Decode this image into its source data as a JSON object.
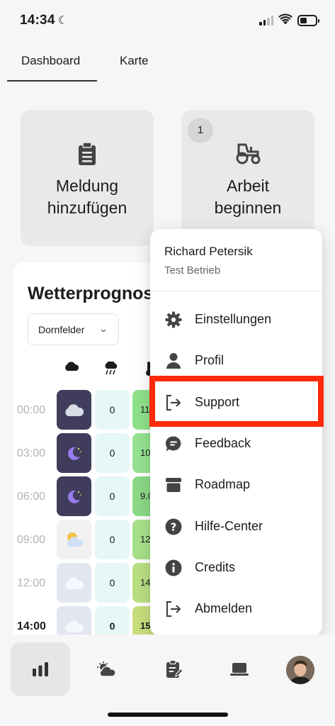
{
  "status_bar": {
    "time": "14:34"
  },
  "tabs": [
    {
      "label": "Dashboard",
      "active": true
    },
    {
      "label": "Karte",
      "active": false
    }
  ],
  "cards": {
    "report": {
      "label": "Meldung\nhinzufügen",
      "icon": "clipboard-icon"
    },
    "work": {
      "label": "Arbeit\nbeginnen",
      "icon": "tractor-icon",
      "badge": "1"
    }
  },
  "weather": {
    "title": "Wetterprognose",
    "location_select": "Dornfelder",
    "columns": [
      "cloud-icon",
      "rain-icon",
      "thermometer-icon"
    ],
    "rows": [
      {
        "time": "00:00",
        "condition": "cloudy-night",
        "rain": "0",
        "temp": "11."
      },
      {
        "time": "03:00",
        "condition": "clear-night",
        "rain": "0",
        "temp": "10."
      },
      {
        "time": "06:00",
        "condition": "clear-night",
        "rain": "0",
        "temp": "9.0"
      },
      {
        "time": "09:00",
        "condition": "partly-sunny",
        "rain": "0",
        "temp": "12."
      },
      {
        "time": "12:00",
        "condition": "cloudy",
        "rain": "0",
        "temp": "14."
      },
      {
        "time": "14:00",
        "condition": "cloudy",
        "rain": "0",
        "temp": "15.",
        "current": true
      }
    ]
  },
  "menu": {
    "user_name": "Richard Petersik",
    "company": "Test Betrieb",
    "items": [
      {
        "label": "Einstellungen",
        "icon": "gear-icon"
      },
      {
        "label": "Profil",
        "icon": "person-icon"
      },
      {
        "label": "Support",
        "icon": "sign-out-icon",
        "highlighted": true
      },
      {
        "label": "Feedback",
        "icon": "chat-bubble-icon"
      },
      {
        "label": "Roadmap",
        "icon": "archive-box-icon"
      },
      {
        "label": "Hilfe-Center",
        "icon": "question-circle-icon"
      },
      {
        "label": "Credits",
        "icon": "info-circle-icon"
      },
      {
        "label": "Abmelden",
        "icon": "sign-out-icon"
      }
    ]
  },
  "bottom_nav": [
    {
      "name": "dashboard",
      "icon": "bar-chart-icon",
      "active": true
    },
    {
      "name": "weather",
      "icon": "cloud-sun-icon"
    },
    {
      "name": "notes",
      "icon": "clipboard-edit-icon"
    },
    {
      "name": "computer",
      "icon": "laptop-icon"
    },
    {
      "name": "profile",
      "icon": "avatar"
    }
  ],
  "colors": {
    "highlight": "#ff2a0b",
    "rain_cell": "#e5f7f7",
    "night_icon_bg": "#3f3c5c",
    "temp_green": "#8fe08a"
  }
}
